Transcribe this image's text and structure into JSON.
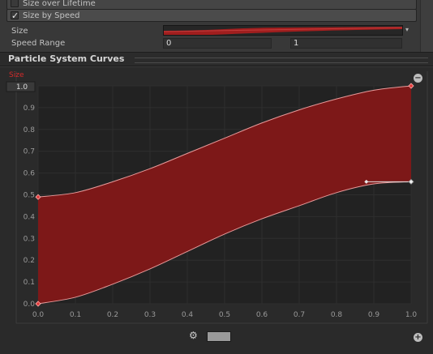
{
  "modules": {
    "size_over_lifetime": {
      "label": "Size over Lifetime",
      "checked": false
    },
    "size_by_speed": {
      "label": "Size by Speed",
      "checked": true,
      "checkmark": "✓"
    }
  },
  "properties": {
    "size_label": "Size",
    "speed_range_label": "Speed Range",
    "speed_min": "0",
    "speed_max": "1",
    "dropdown_arrow": "▾"
  },
  "curves_panel": {
    "title": "Particle System Curves",
    "curve_label": "Size",
    "y_field_value": "1.0",
    "remove_icon": "minus-circle-icon",
    "add_icon": "plus-circle-icon",
    "gear_icon": "gear-icon",
    "gear_glyph": "⚙"
  },
  "colors": {
    "curve_fill": "#7d1818",
    "curve_line": "#e89a9a",
    "curve_label": "#d42a2a",
    "key_point": "#e03a3a"
  },
  "chart_data": {
    "type": "area",
    "xlim": [
      0,
      1
    ],
    "ylim": [
      0,
      1
    ],
    "x_ticks": [
      "0.0",
      "0.1",
      "0.2",
      "0.3",
      "0.4",
      "0.5",
      "0.6",
      "0.7",
      "0.8",
      "0.9",
      "1.0"
    ],
    "y_ticks": [
      "0.0",
      "0.1",
      "0.2",
      "0.3",
      "0.4",
      "0.5",
      "0.6",
      "0.7",
      "0.8",
      "0.9",
      "1.0"
    ],
    "grid": true,
    "series": [
      {
        "name": "",
        "role": "upper",
        "x": [
          0,
          0.1,
          0.2,
          0.3,
          0.4,
          0.5,
          0.6,
          0.7,
          0.8,
          0.9,
          1.0
        ],
        "values": [
          0.49,
          0.51,
          0.56,
          0.62,
          0.69,
          0.76,
          0.83,
          0.89,
          0.94,
          0.98,
          1.0
        ]
      },
      {
        "name": "",
        "role": "lower",
        "x": [
          0,
          0.1,
          0.2,
          0.3,
          0.4,
          0.5,
          0.6,
          0.7,
          0.8,
          0.9,
          1.0
        ],
        "values": [
          0.0,
          0.03,
          0.09,
          0.16,
          0.24,
          0.32,
          0.39,
          0.45,
          0.51,
          0.55,
          0.56
        ]
      }
    ],
    "keys": [
      {
        "x": 0,
        "y": 0.49
      },
      {
        "x": 1.0,
        "y": 1.0
      },
      {
        "x": 0,
        "y": 0.0
      },
      {
        "x": 1.0,
        "y": 0.56
      }
    ],
    "tangent_handle": {
      "x": 0.88,
      "y": 0.56
    }
  }
}
